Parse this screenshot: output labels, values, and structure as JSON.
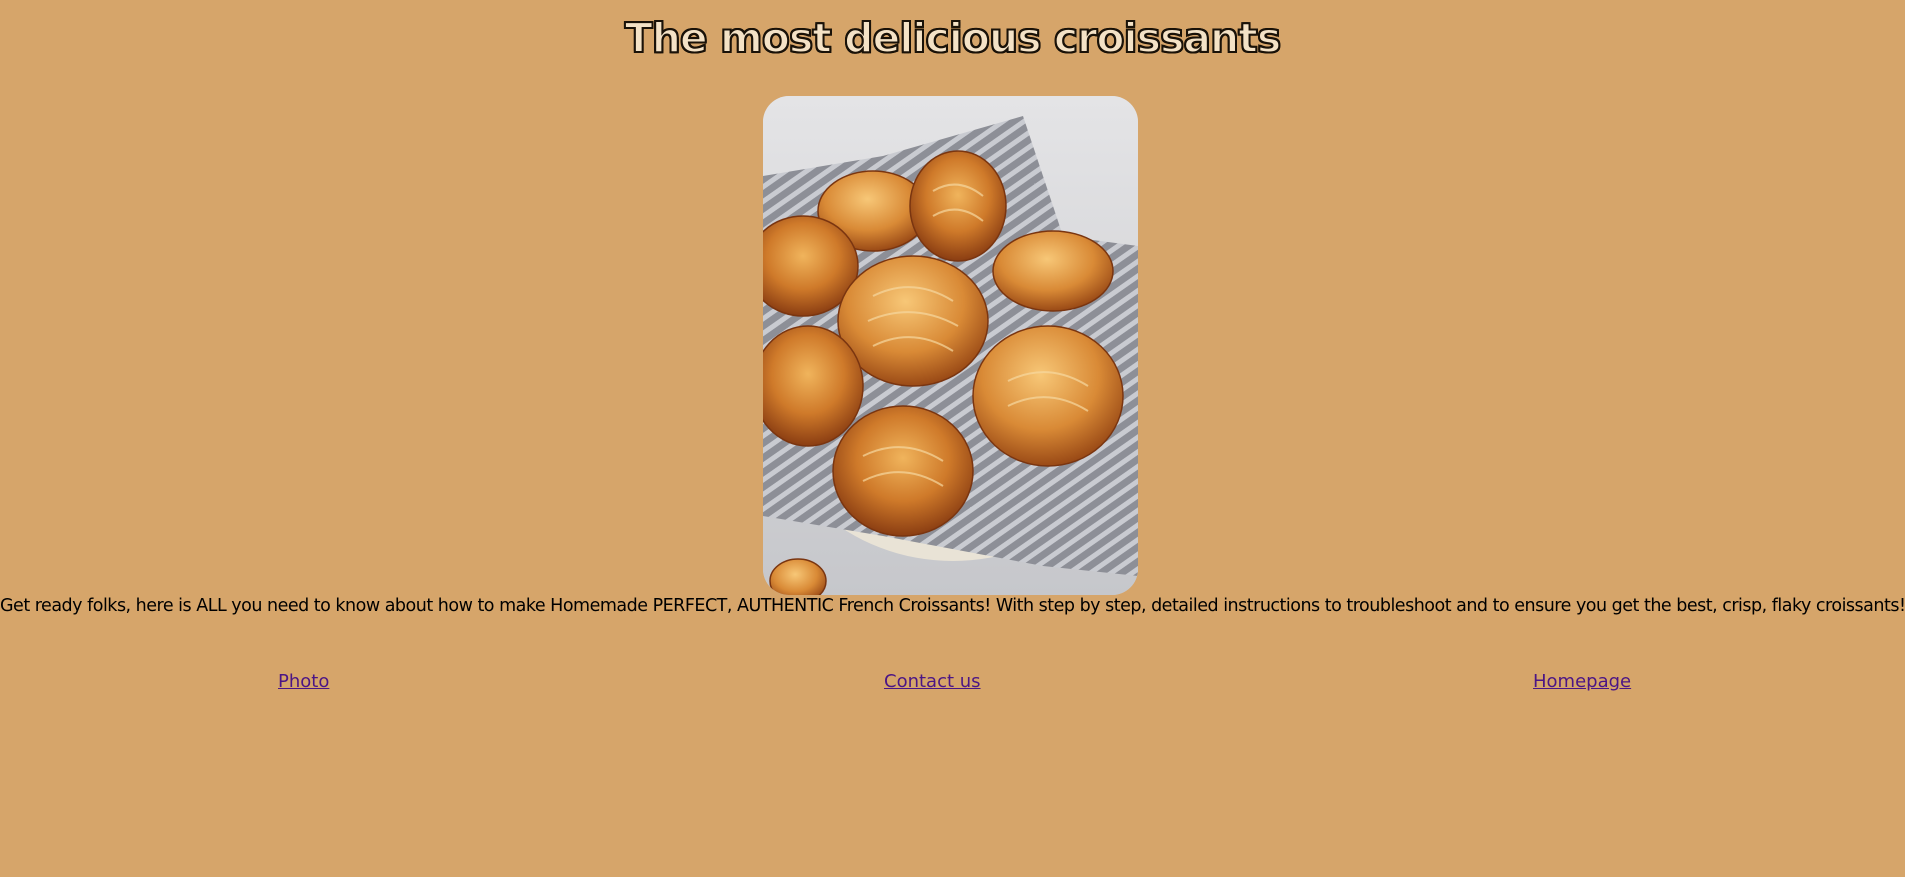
{
  "header": {
    "title": "The most delicious croissants"
  },
  "hero_image": {
    "alt": "Basket of croissants on a striped cloth"
  },
  "intro": {
    "text": "Get ready folks, here is ALL you need to know about how to make Homemade PERFECT, AUTHENTIC French Croissants! With step by step, detailed instructions to troubleshoot and to ensure you get the best, crisp, flaky croissants!"
  },
  "nav": {
    "links": [
      {
        "label": "Photo"
      },
      {
        "label": "Contact us"
      },
      {
        "label": "Homepage"
      }
    ]
  },
  "colors": {
    "background": "#d6a56a",
    "link": "#4b1585",
    "text": "#000000"
  }
}
